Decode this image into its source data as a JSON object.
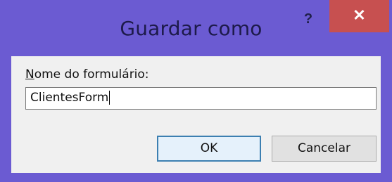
{
  "window": {
    "title": "Guardar como",
    "help_label": "?",
    "close_label": "✕"
  },
  "form": {
    "label_accel": "N",
    "label_rest": "ome do formulário:",
    "input_value": "ClientesForm"
  },
  "buttons": {
    "ok_label": "OK",
    "cancel_label": "Cancelar"
  },
  "colors": {
    "frame": "#6b5bd2",
    "close": "#c75050",
    "client": "#f0f0f0",
    "ok_border": "#3c7fb1"
  }
}
